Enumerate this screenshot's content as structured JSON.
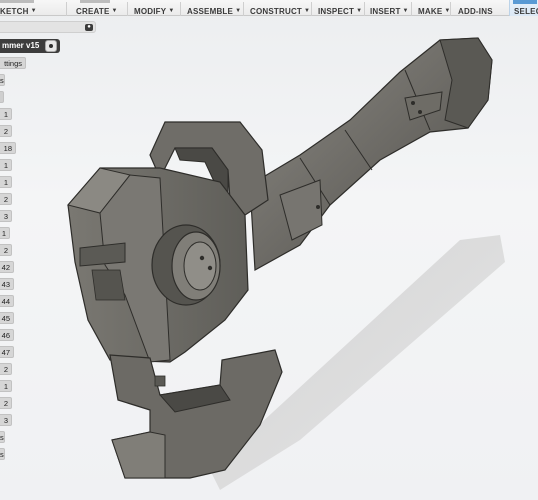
{
  "toolbar": {
    "items": [
      {
        "label": "KETCH",
        "id": "sketch"
      },
      {
        "label": "CREATE",
        "id": "create"
      },
      {
        "label": "MODIFY",
        "id": "modify"
      },
      {
        "label": "ASSEMBLE",
        "id": "assemble"
      },
      {
        "label": "CONSTRUCT",
        "id": "construct"
      },
      {
        "label": "INSPECT",
        "id": "inspect"
      },
      {
        "label": "INSERT",
        "id": "insert"
      },
      {
        "label": "MAKE",
        "id": "make"
      },
      {
        "label": "ADD-INS",
        "id": "addins"
      },
      {
        "label": "SELECT",
        "id": "select"
      }
    ],
    "caret": "▼"
  },
  "browser": {
    "document_name": "mmer v15",
    "items": [
      {
        "label": "ttings"
      },
      {
        "label": "s"
      },
      {
        "label": ""
      },
      {
        "label": "1"
      },
      {
        "label": "2"
      },
      {
        "label": "18"
      },
      {
        "label": "1"
      },
      {
        "label": "1"
      },
      {
        "label": "2"
      },
      {
        "label": "3"
      },
      {
        "label": "1"
      },
      {
        "label": "2"
      },
      {
        "label": "42"
      },
      {
        "label": "43"
      },
      {
        "label": "44"
      },
      {
        "label": "45"
      },
      {
        "label": "46"
      },
      {
        "label": "47"
      },
      {
        "label": "2"
      },
      {
        "label": "1"
      },
      {
        "label": "2"
      },
      {
        "label": "3"
      },
      {
        "label": "s"
      },
      {
        "label": "s"
      }
    ]
  },
  "colors": {
    "accent": "#5a9ad4",
    "model_face": "#6b6a65",
    "model_dark": "#3f3e3a",
    "model_light": "#8a8882"
  }
}
